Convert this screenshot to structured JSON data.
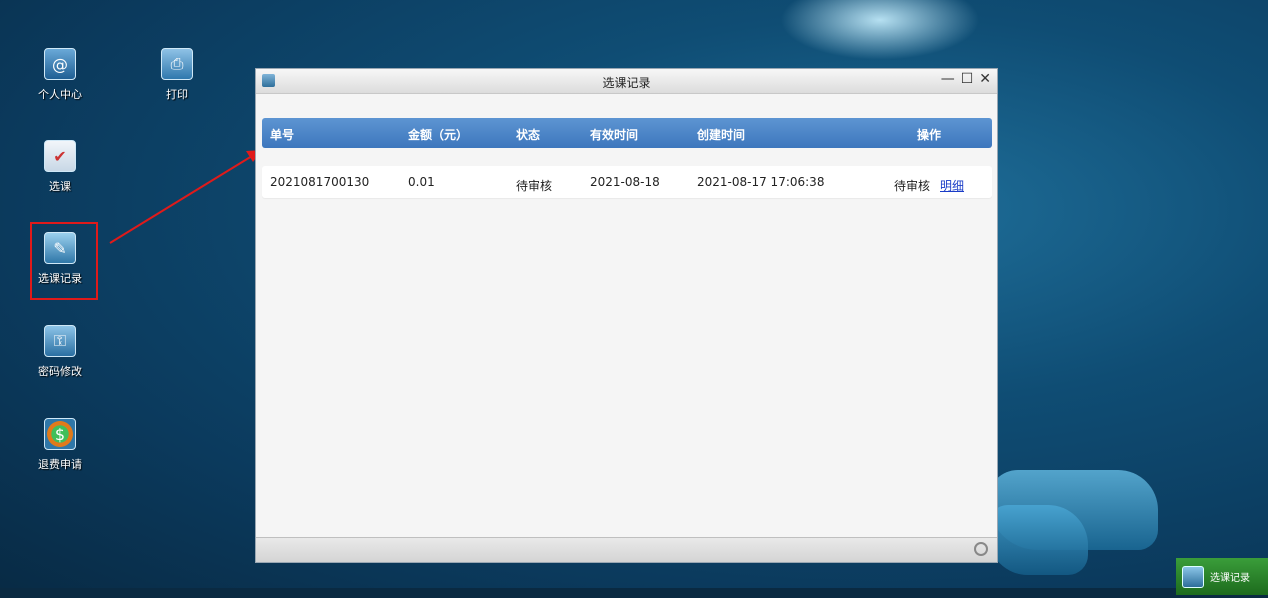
{
  "desktop": {
    "icons": [
      {
        "label": "个人中心",
        "icon": "address-book-icon"
      },
      {
        "label": "打印",
        "icon": "printer-icon"
      },
      {
        "label": "选课",
        "icon": "course-select-icon"
      },
      {
        "label": "选课记录",
        "icon": "course-record-icon"
      },
      {
        "label": "密码修改",
        "icon": "password-change-icon"
      },
      {
        "label": "退费申请",
        "icon": "refund-icon"
      }
    ]
  },
  "window": {
    "title": "选课记录",
    "controls": {
      "minimize": "—",
      "maximize": "☐",
      "close": "✕"
    },
    "table": {
      "headers": [
        "单号",
        "金额（元）",
        "状态",
        "有效时间",
        "创建时间",
        "操作"
      ],
      "rows": [
        {
          "order_no": "2021081700130",
          "amount": "0.01",
          "status": "待审核",
          "valid_date": "2021-08-18",
          "created": "2021-08-17 17:06:38",
          "op_status": "待审核",
          "op_link": "明细"
        }
      ]
    }
  },
  "taskbar": {
    "item_label": "选课记录"
  },
  "colors": {
    "header_blue": "#4a86c8",
    "highlight_red": "#e01a1a",
    "taskbar_green": "#2e8b2e"
  }
}
